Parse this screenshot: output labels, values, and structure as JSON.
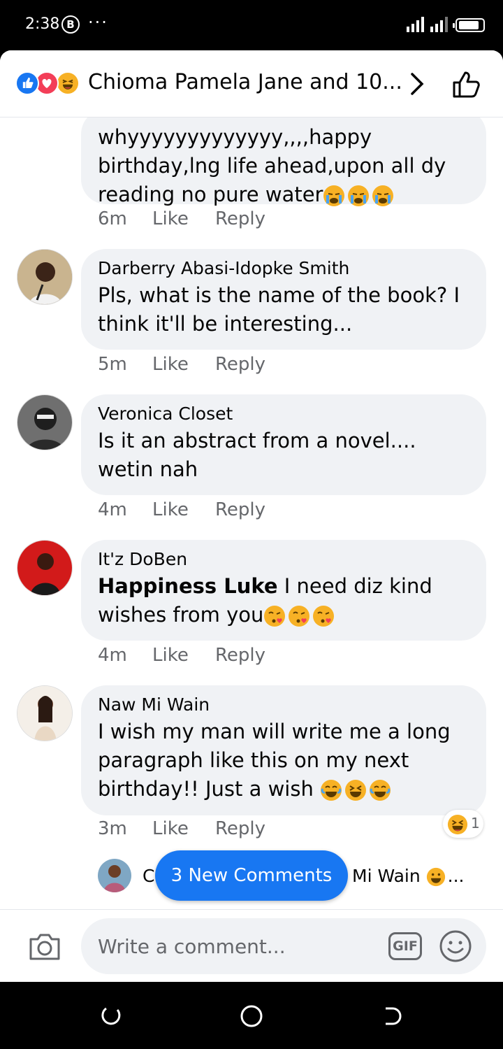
{
  "status_bar": {
    "time": "2:38",
    "b_badge": "B",
    "more": "···"
  },
  "header": {
    "title": "Chioma Pamela Jane and 10...",
    "reactions": [
      "like-icon",
      "love-icon",
      "haha-icon"
    ]
  },
  "comments": [
    {
      "author": "",
      "text": "whyyyyyyyyyyyyy,,,,happy birthday,lng life ahead,upon all dy reading no pure water",
      "emojis": [
        "crying-face",
        "crying-face",
        "crying-face"
      ],
      "time": "6m",
      "like": "Like",
      "reply": "Reply"
    },
    {
      "author": "Darberry Abasi-Idopke Smith",
      "text": "Pls, what is the name of the book? I think it'll be interesting...",
      "time": "5m",
      "like": "Like",
      "reply": "Reply"
    },
    {
      "author": "Veronica Closet",
      "text": "Is it an abstract from a novel.... wetin nah",
      "time": "4m",
      "like": "Like",
      "reply": "Reply"
    },
    {
      "author": "It'z DoBen",
      "mention": "Happiness Luke",
      "text": " I need diz kind wishes from you",
      "emojis": [
        "kiss-face",
        "kiss-face",
        "kiss-face"
      ],
      "time": "4m",
      "like": "Like",
      "reply": "Reply"
    },
    {
      "author": "Naw Mi Wain",
      "text": "I wish my man will write me a long paragraph like this on my next birthday!! Just a wish ",
      "emojis": [
        "tears-of-joy-face",
        "laughing-face",
        "tears-of-joy-face"
      ],
      "time": "3m",
      "like": "Like",
      "reply": "Reply",
      "reaction_count": "1"
    }
  ],
  "reply_preview": {
    "prefix": "C",
    "text": "Mi Wain",
    "ellipsis": "..."
  },
  "new_comments_label": "3 New Comments",
  "composer": {
    "placeholder": "Write a comment...",
    "gif_label": "GIF"
  },
  "colors": {
    "brand_blue": "#1877f2",
    "bubble_gray": "#f0f2f5",
    "meta_gray": "#65676b"
  }
}
